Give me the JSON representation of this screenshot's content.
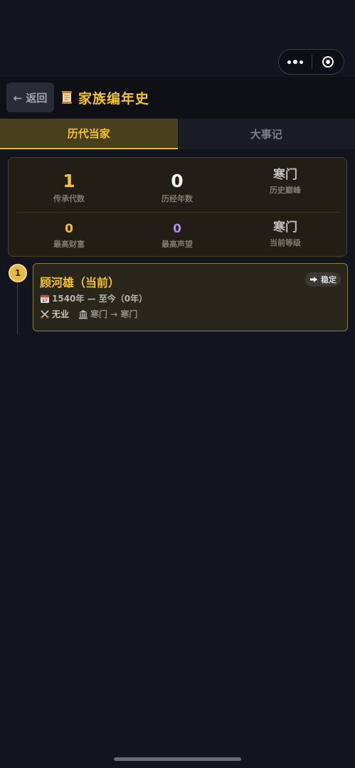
{
  "header": {
    "back_label": "← 返回",
    "title": "家族编年史",
    "title_icon": "scroll-icon"
  },
  "tabs": [
    {
      "label": "历代当家",
      "active": true
    },
    {
      "label": "大事记",
      "active": false
    }
  ],
  "stats": [
    {
      "value": "1",
      "label": "传承代数"
    },
    {
      "value": "0",
      "label": "历经年数"
    },
    {
      "value": "寒门",
      "label": "历史巅峰"
    },
    {
      "value": "0",
      "label": "最高财富"
    },
    {
      "value": "0",
      "label": "最高声望"
    },
    {
      "value": "寒门",
      "label": "当前等级"
    }
  ],
  "generations": [
    {
      "index": "1",
      "name": "顾河雄（当前）",
      "status": "稳定",
      "period": "1540年 — 至今（0年）",
      "job": "无业",
      "rank": "寒门 → 寒门"
    }
  ],
  "colors": {
    "accent_gold": "#f3c22a",
    "purple": "#b48ae8",
    "background": "#12151d"
  }
}
